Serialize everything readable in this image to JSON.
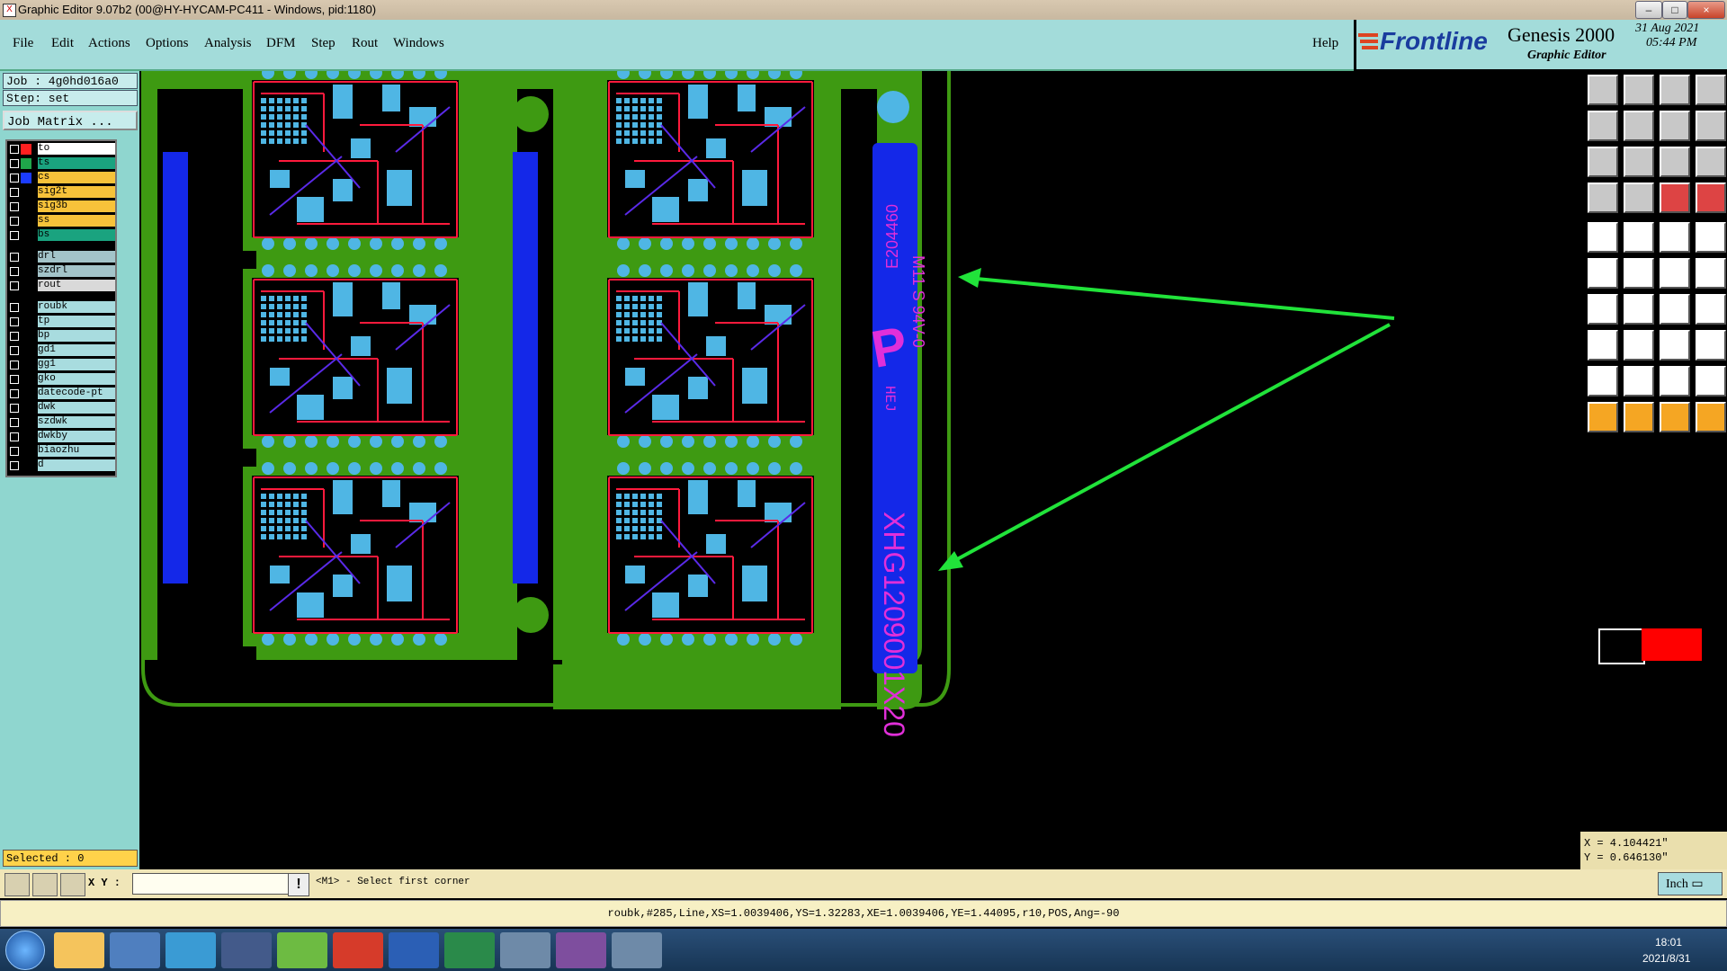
{
  "window": {
    "title": "Graphic Editor 9.07b2 (00@HY-HYCAM-PC411 - Windows, pid:1180)",
    "min": "–",
    "max": "□",
    "close": "×"
  },
  "menu": [
    "File",
    "Edit",
    "Actions",
    "Options",
    "Analysis",
    "DFM",
    "Step",
    "Rout",
    "Windows"
  ],
  "help": "Help",
  "brand": {
    "logo": "Frontline",
    "product": "Genesis 2000",
    "subtitle": "Graphic Editor",
    "date": "31 Aug 2021",
    "time": "05:44 PM"
  },
  "job": {
    "job": "Job : 4g0hd016a0",
    "step": "Step: set",
    "matrix_button": "Job Matrix ..."
  },
  "layers": [
    {
      "name": "to",
      "color": "#ff2020",
      "bg": "#ffffff"
    },
    {
      "name": "ts",
      "color": "#1fa64a",
      "bg": "#1aa37f"
    },
    {
      "name": "cs",
      "color": "#1b3cff",
      "bg": "#f7c23a"
    },
    {
      "name": "sig2t",
      "color": "",
      "bg": "#f7c23a"
    },
    {
      "name": "sig3b",
      "color": "",
      "bg": "#f7c23a"
    },
    {
      "name": "ss",
      "color": "",
      "bg": "#f7c23a"
    },
    {
      "name": "bs",
      "color": "",
      "bg": "#1aa37f"
    },
    {
      "name": "drl",
      "color": "",
      "bg": "#a3c4c9"
    },
    {
      "name": "szdrl",
      "color": "",
      "bg": "#a3c4c9"
    },
    {
      "name": "rout",
      "color": "",
      "bg": "#d9d9d9"
    },
    {
      "name": "roubk",
      "color": "",
      "bg": "#a8dcdf"
    },
    {
      "name": "tp",
      "color": "",
      "bg": "#a8dcdf"
    },
    {
      "name": "bp",
      "color": "",
      "bg": "#a8dcdf"
    },
    {
      "name": "gd1",
      "color": "",
      "bg": "#a8dcdf"
    },
    {
      "name": "gg1",
      "color": "",
      "bg": "#a8dcdf"
    },
    {
      "name": "gko",
      "color": "",
      "bg": "#a8dcdf"
    },
    {
      "name": "datecode-pt",
      "color": "",
      "bg": "#a8dcdf"
    },
    {
      "name": "dwk",
      "color": "",
      "bg": "#a8dcdf"
    },
    {
      "name": "szdwk",
      "color": "",
      "bg": "#a8dcdf"
    },
    {
      "name": "dwkby",
      "color": "",
      "bg": "#a8dcdf"
    },
    {
      "name": "biaozhu",
      "color": "",
      "bg": "#a8dcdf"
    },
    {
      "name": "d",
      "color": "",
      "bg": "#a8dcdf"
    }
  ],
  "selected": "Selected : 0",
  "board": {
    "marking_ul": "E204460",
    "marking_spec": "M11 S 94V-0",
    "logo_letter": "P",
    "panel_code": "XHG1209001X20",
    "date_code": "HEJ"
  },
  "coords": {
    "x": "X = 4.104421\"",
    "y": "Y = 0.646130\""
  },
  "command": {
    "xy_label": "X Y :",
    "xy_value": "",
    "warn": "!",
    "prompt": "<M1> - Select first corner",
    "units": "Inch"
  },
  "status": "roubk,#285,Line,XS=1.0039406,YS=1.32283,XE=1.0039406,YE=1.44095,r10,POS,Ang=-90",
  "taskbar": {
    "clock_time": "18:01",
    "clock_date": "2021/8/31"
  },
  "colors": {
    "teal": "#a3dcda",
    "green": "#3e9a12",
    "copper": "#4fb6e4",
    "trace": "#ff1a3c",
    "blue": "#1428e8",
    "magenta": "#e12fd9",
    "arrow": "#21e33a"
  }
}
